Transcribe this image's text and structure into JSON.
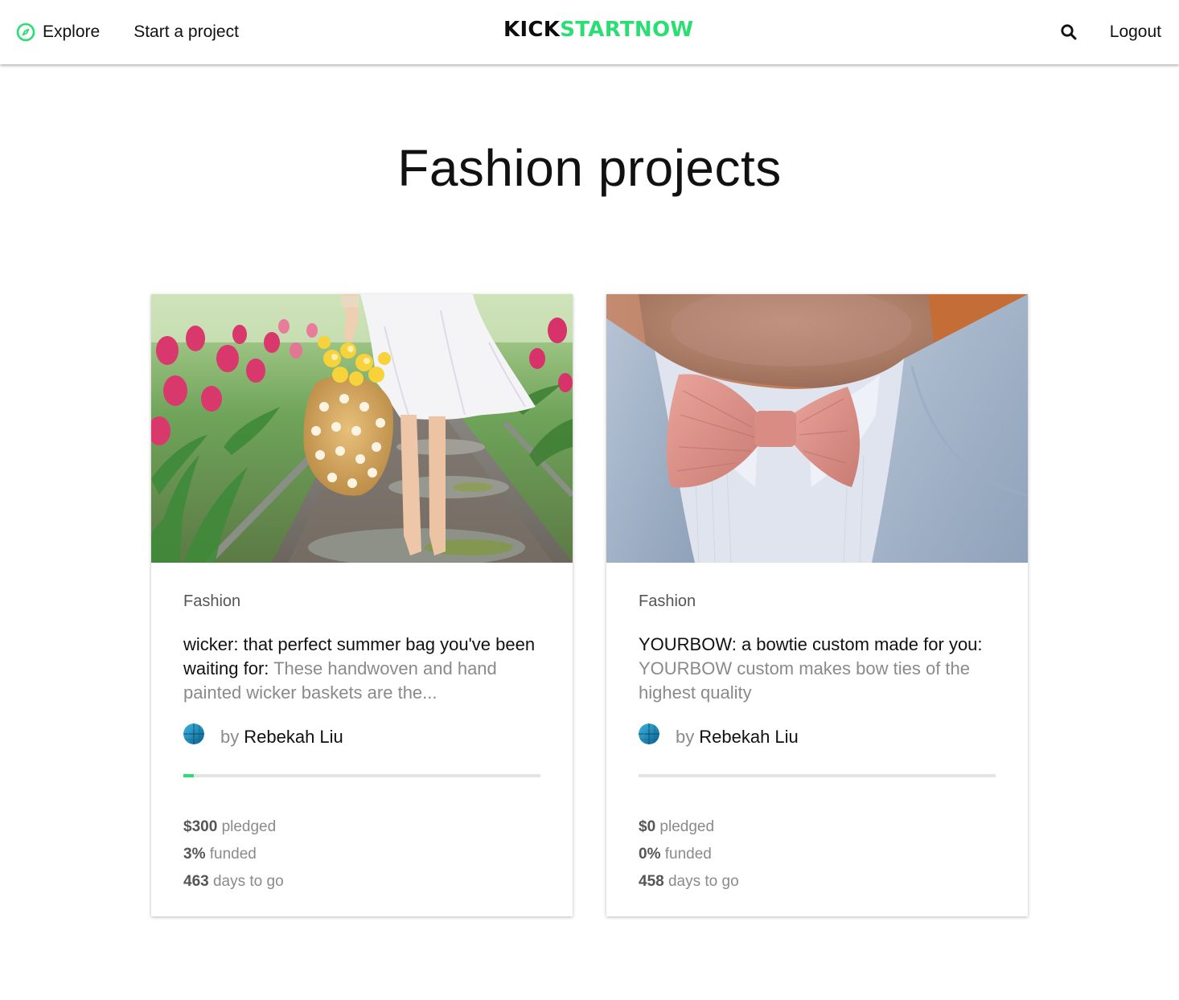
{
  "header": {
    "explore_label": "Explore",
    "start_label": "Start a project",
    "logo_part1": "KICK",
    "logo_part2": "STARTNOW",
    "logout_label": "Logout",
    "accent_color": "#2bde73"
  },
  "page": {
    "title": "Fashion projects"
  },
  "projects": [
    {
      "category": "Fashion",
      "title": "wicker: that perfect summer bag you've been waiting for:",
      "description": "These handwoven and hand painted wicker baskets are the...",
      "by": "by",
      "creator": "Rebekah Liu",
      "funded_fraction": 0.03,
      "pledged_value": "$300",
      "pledged_label": "pledged",
      "funded_value": "3%",
      "funded_label": "funded",
      "days_value": "463",
      "days_label": "days to go"
    },
    {
      "category": "Fashion",
      "title": "YOURBOW: a bowtie custom made for you:",
      "description": "YOURBOW custom makes bow ties of the highest quality",
      "by": "by",
      "creator": "Rebekah Liu",
      "funded_fraction": 0.0,
      "pledged_value": "$0",
      "pledged_label": "pledged",
      "funded_value": "0%",
      "funded_label": "funded",
      "days_value": "458",
      "days_label": "days to go"
    }
  ]
}
